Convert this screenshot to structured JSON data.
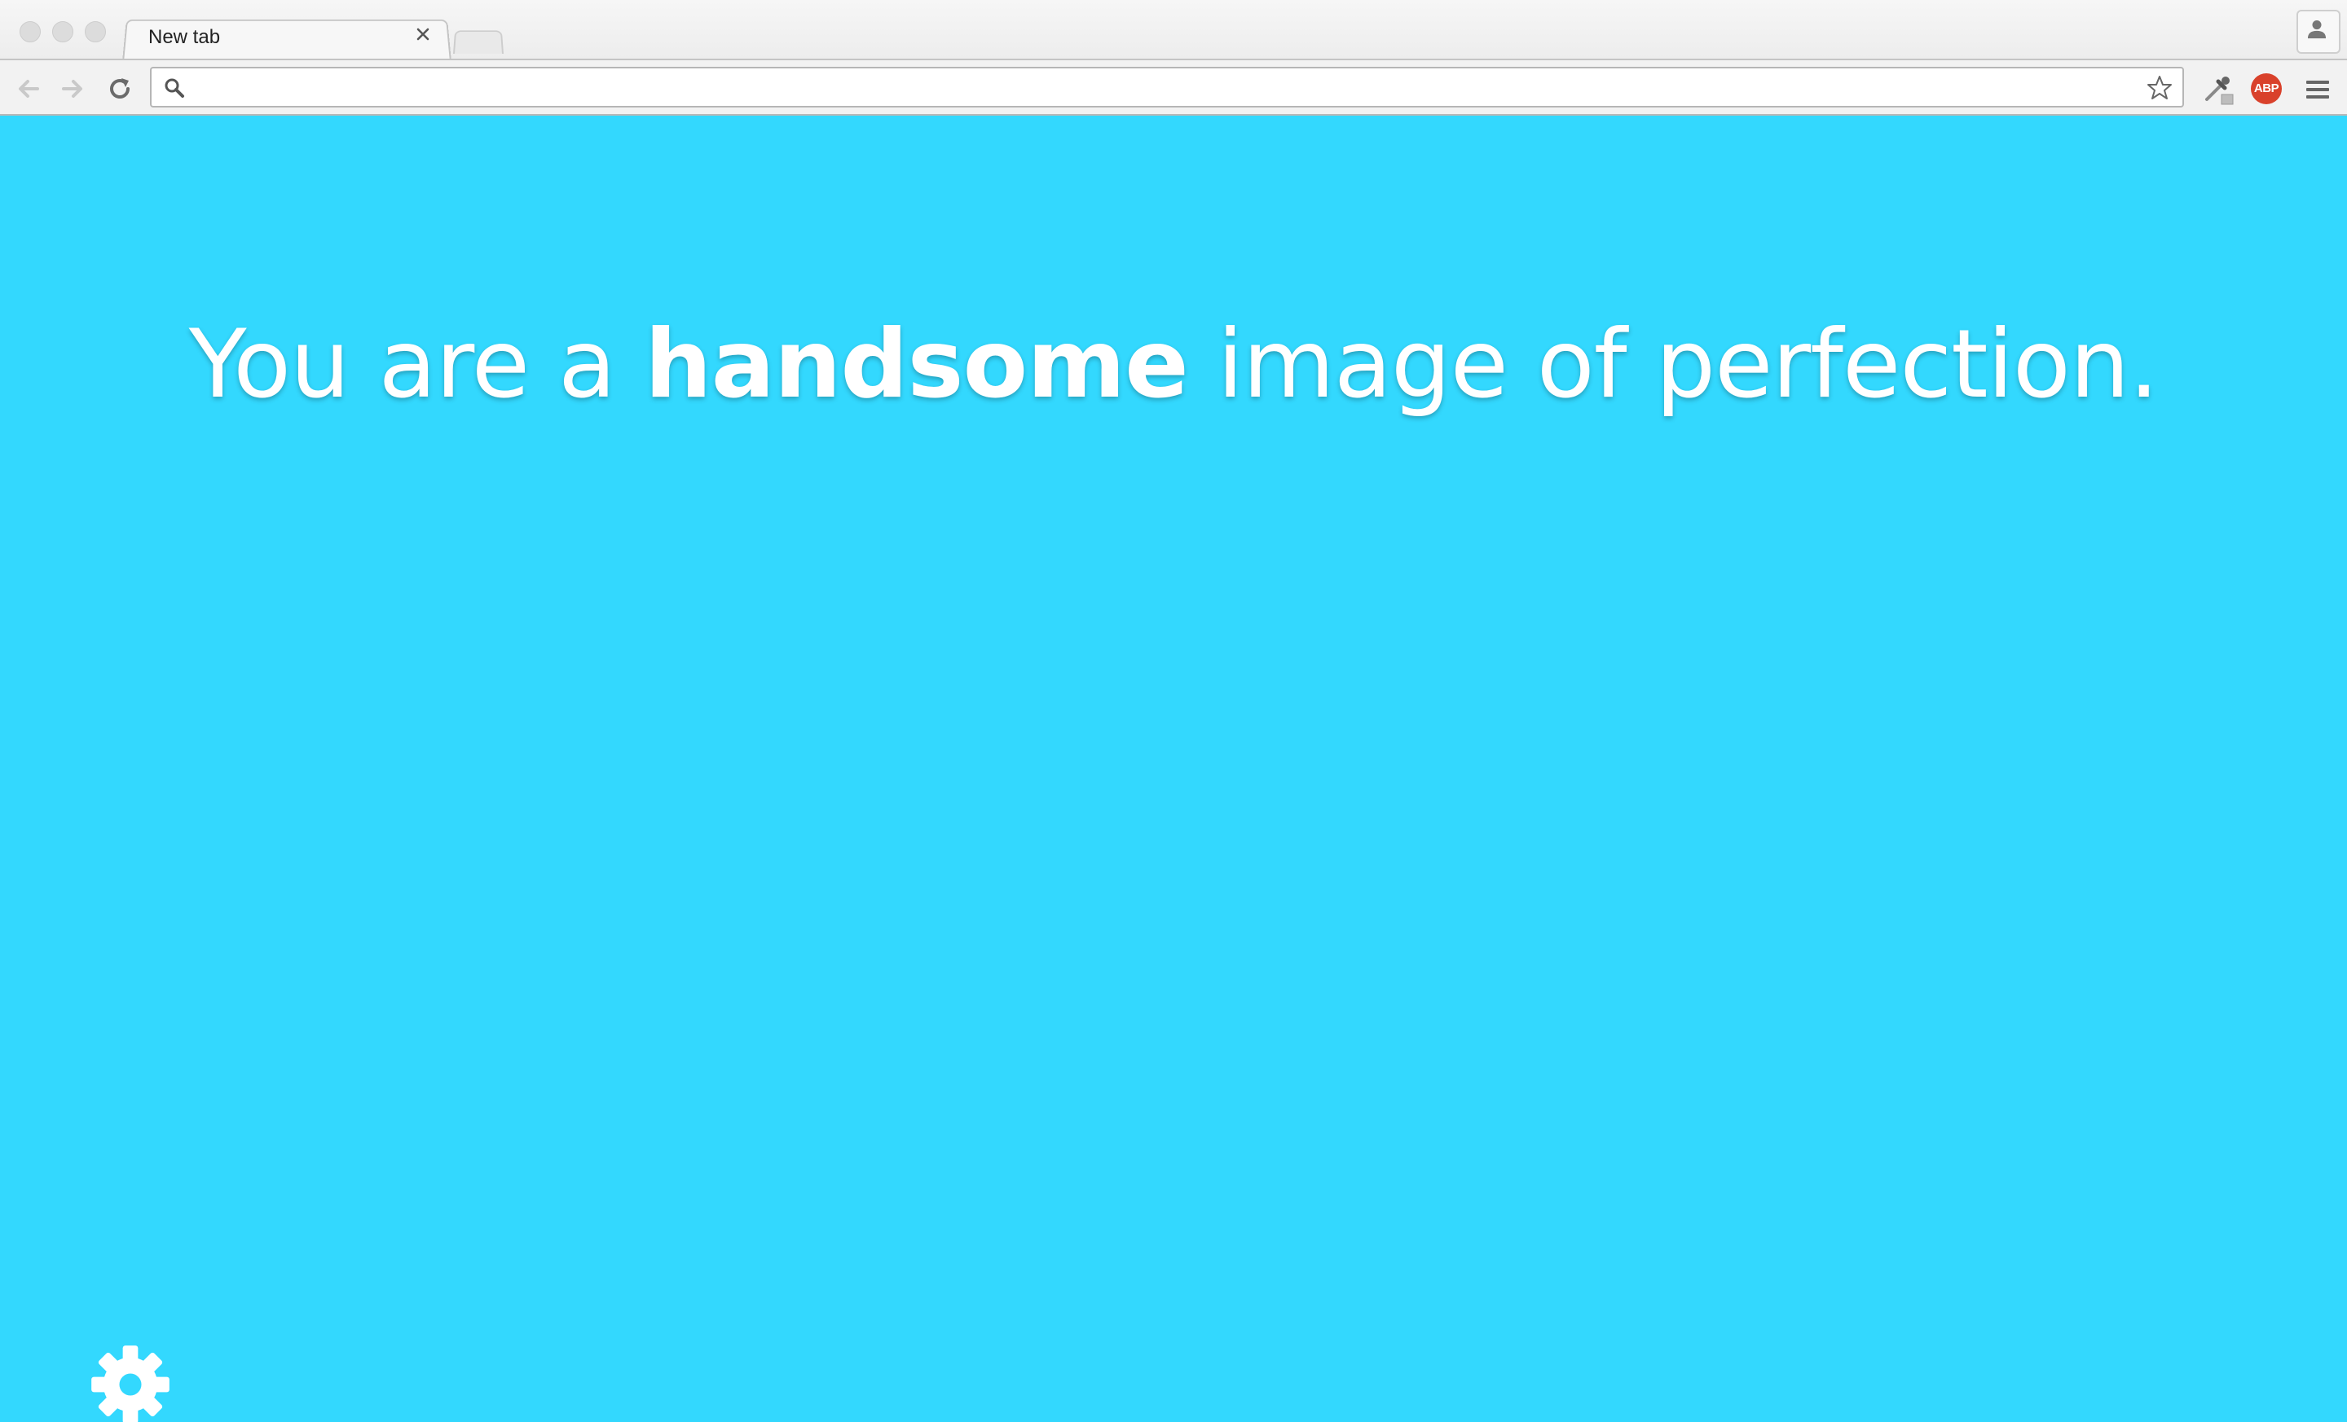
{
  "browser": {
    "tab": {
      "title": "New tab",
      "close_icon": "close-icon"
    },
    "new_tab_icon": "new-tab-icon",
    "profile_icon": "person-icon"
  },
  "toolbar": {
    "back_icon": "arrow-left-icon",
    "forward_icon": "arrow-right-icon",
    "reload_icon": "reload-icon",
    "omnibox": {
      "value": "",
      "placeholder": "",
      "search_icon": "search-icon",
      "bookmark_icon": "star-icon"
    },
    "extensions": [
      {
        "icon": "eyedropper-icon"
      },
      {
        "icon": "adblock-icon",
        "label": "ABP"
      }
    ],
    "menu_icon": "hamburger-icon"
  },
  "page": {
    "background": "#33d8fe",
    "compliment": {
      "before": "You are a",
      "emphasis": "handsome",
      "after": "image of perfection."
    },
    "settings_icon": "gear-icon"
  }
}
